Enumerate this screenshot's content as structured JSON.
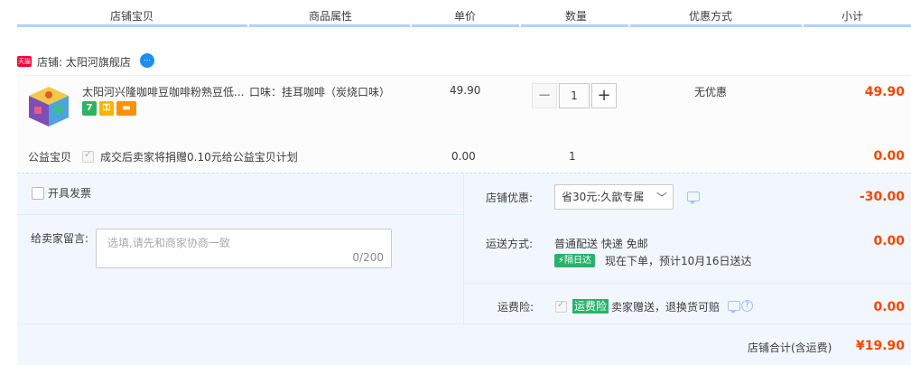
{
  "header": {
    "columns": [
      "店铺宝贝",
      "商品属性",
      "单价",
      "数量",
      "优惠方式",
      "小计"
    ]
  },
  "shop": {
    "badge": "天猫",
    "label": "店铺: 太阳河旗舰店",
    "chat_icon": "chat-bubble-icon"
  },
  "item": {
    "title": "太阳河兴隆咖啡豆咖啡粉熟豆低...",
    "attribute": "口味：挂耳咖啡（炭烧口味）",
    "price": "49.90",
    "quantity": "1",
    "promotion": "无优惠",
    "subtotal": "49.90",
    "service_icons": [
      "seven-day-return-icon",
      "guarantee-icon",
      "card-icon"
    ],
    "service_icon_texts": [
      "7",
      "",
      ""
    ],
    "service_icon_colors": [
      "#2fb362",
      "#f9b300",
      "#ff9000"
    ]
  },
  "charity": {
    "label": "公益宝贝",
    "text": "成交后卖家将捐赠0.10元给公益宝贝计划",
    "price": "0.00",
    "quantity": "1",
    "subtotal": "0.00"
  },
  "invoice": {
    "label": "开具发票"
  },
  "message": {
    "label": "给卖家留言:",
    "placeholder": "选填,请先和商家协商一致",
    "counter": "0/200"
  },
  "shop_discount": {
    "label": "店铺优惠:",
    "selected": "省30元:久歆专属",
    "amount": "-30.00"
  },
  "shipping": {
    "label": "运送方式:",
    "method": "普通配送 快递 免邮",
    "badge": "隔日达",
    "eta": "现在下单，预计10月16日送达",
    "amount": "0.00"
  },
  "shipping_insurance": {
    "label": "运费险:",
    "badge": "运费险",
    "text": "卖家赠送，退换货可赔",
    "amount": "0.00"
  },
  "total": {
    "label": "店铺合计(含运费)",
    "amount": "¥19.90"
  },
  "colors": {
    "accent_price": "#ff4400",
    "header_bar": "#b2d1ff",
    "lower_bg": "#f2f7ff",
    "green_badge": "#27b36b"
  }
}
